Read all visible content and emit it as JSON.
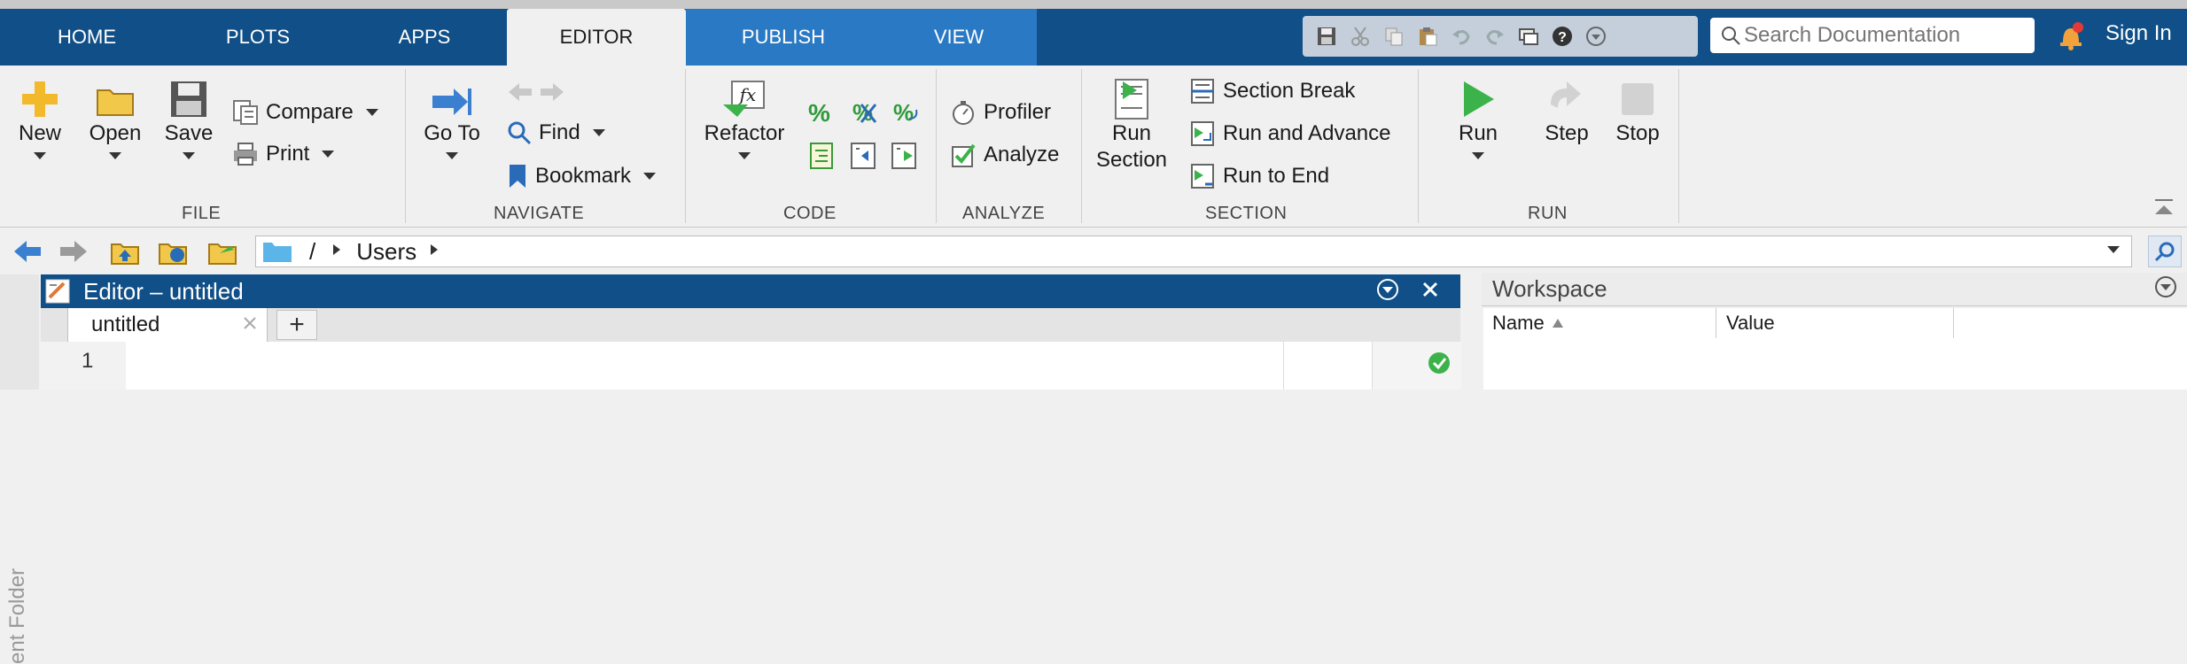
{
  "tabs": [
    {
      "label": "HOME"
    },
    {
      "label": "PLOTS"
    },
    {
      "label": "APPS"
    },
    {
      "label": "EDITOR"
    },
    {
      "label": "PUBLISH"
    },
    {
      "label": "VIEW"
    }
  ],
  "search": {
    "placeholder": "Search Documentation"
  },
  "signin": "Sign In",
  "file_group": {
    "label": "FILE",
    "new": "New",
    "open": "Open",
    "save": "Save",
    "compare": "Compare",
    "print": "Print"
  },
  "navigate_group": {
    "label": "NAVIGATE",
    "goto": "Go To",
    "find": "Find",
    "bookmark": "Bookmark"
  },
  "code_group": {
    "label": "CODE",
    "refactor": "Refactor",
    "percent": "%"
  },
  "analyze_group": {
    "label": "ANALYZE",
    "profiler": "Profiler",
    "analyze": "Analyze"
  },
  "section_group": {
    "label": "SECTION",
    "run_section_1": "Run",
    "run_section_2": "Section",
    "section_break": "Section Break",
    "run_and_advance": "Run and Advance",
    "run_to_end": "Run to End"
  },
  "run_group": {
    "label": "RUN",
    "run": "Run",
    "step": "Step",
    "stop": "Stop"
  },
  "address": {
    "root": "/",
    "users": "Users"
  },
  "editor": {
    "title": "Editor – untitled",
    "tab": "untitled",
    "add_tab": "+",
    "line_number": "1"
  },
  "side_strip_text": "ent Folder",
  "workspace": {
    "title": "Workspace",
    "col_name": "Name",
    "col_value": "Value"
  },
  "colors": {
    "tabbar": "#104f87",
    "editor_tab_active": "#f0f0f0",
    "publish_view_tabs": "#2a79c4",
    "editor_titlebar": "#104f87",
    "run_green": "#3cb34a"
  }
}
